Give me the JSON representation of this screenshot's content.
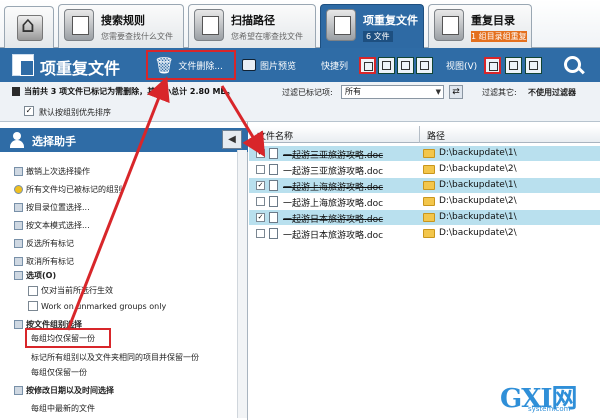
{
  "tabs": [
    {
      "title": "",
      "subtitle": ""
    },
    {
      "title": "搜索规则",
      "subtitle": "您需要查找什么文件"
    },
    {
      "title": "扫描路径",
      "subtitle": "您希望在哪查找文件"
    },
    {
      "title": "项重复文件",
      "subtitle": "6 文件"
    },
    {
      "title": "重复目录",
      "subtitle": "1 组目录组重复"
    }
  ],
  "toolbar": {
    "title": "项重复文件",
    "delete_label": "文件删除...",
    "preview_label": "图片预览",
    "quick_label": "快捷列",
    "view_label": "视图(V)"
  },
  "status": {
    "summary": "当前共 3 项文件已标记为需删除，其大小总计 2.80 MB。",
    "filter_marked_label": "过滤已标记项:",
    "filter_marked_value": "所有",
    "filter_other_label": "过滤其它:",
    "filter_other_value": "不使用过滤器",
    "group_priority_label": "默认按组别优先排序"
  },
  "helper": {
    "title": "选择助手",
    "items": [
      "撤销上次选择操作",
      "所有文件均已被标记的组别",
      "按目录位置选择...",
      "按文本模式选择...",
      "反选所有标记",
      "取消所有标记",
      "选项(O)",
      "仅对当前所选行生效",
      "Work on unmarked groups only",
      "按文件组别选择",
      "每组均仅保留一份",
      "标记所有组别以及文件夹相同的项目并保留一份",
      "每组仅保留一份",
      "按修改日期以及时间选择",
      "每组中最新的文件"
    ]
  },
  "grid": {
    "col_name": "文件名称",
    "col_path": "路径",
    "rows": [
      {
        "name": "一起游三亚旅游攻略.doc",
        "path": "D:\\backupdate\\1\\",
        "checked": "✓",
        "marked": true
      },
      {
        "name": "一起游三亚旅游攻略.doc",
        "path": "D:\\backupdate\\2\\",
        "checked": "",
        "marked": false
      },
      {
        "name": "一起游上海旅游攻略.doc",
        "path": "D:\\backupdate\\1\\",
        "checked": "✓",
        "marked": true
      },
      {
        "name": "一起游上海旅游攻略.doc",
        "path": "D:\\backupdate\\2\\",
        "checked": "",
        "marked": false
      },
      {
        "name": "一起游日本旅游攻略.doc",
        "path": "D:\\backupdate\\1\\",
        "checked": "✓",
        "marked": true
      },
      {
        "name": "一起游日本旅游攻略.doc",
        "path": "D:\\backupdate\\2\\",
        "checked": "",
        "marked": false
      }
    ]
  },
  "watermark": {
    "logo": "GXI网",
    "sub": "system.com"
  },
  "colors": {
    "accent": "#2f6ca6",
    "annotation": "#d8262a",
    "row_selected": "#b9e0ee",
    "badge": "#e4701e"
  }
}
